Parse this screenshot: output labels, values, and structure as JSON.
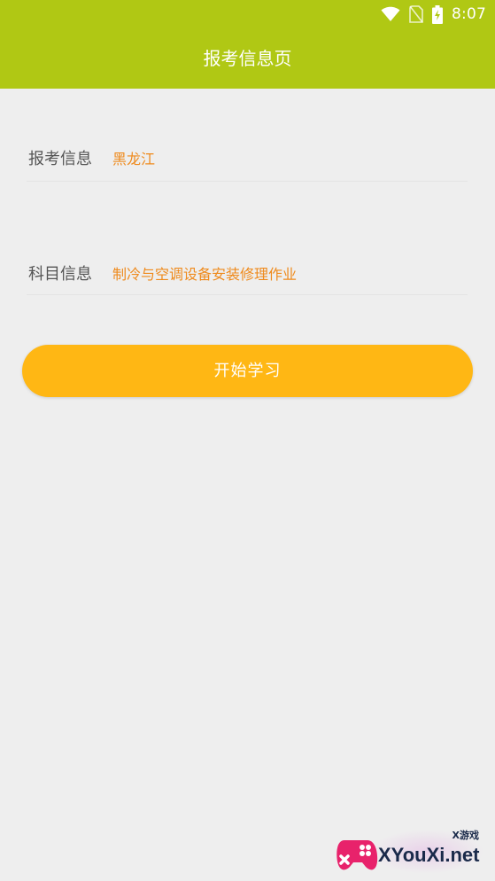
{
  "status_bar": {
    "time": "8:07",
    "icons": [
      "wifi-icon",
      "no-sim-icon",
      "battery-charging-icon"
    ]
  },
  "app_bar": {
    "title": "报考信息页",
    "color": "#b0c814"
  },
  "form": {
    "exam_info": {
      "label": "报考信息",
      "value": "黑龙江"
    },
    "subject_info": {
      "label": "科目信息",
      "value": "制冷与空调设备安装修理作业"
    }
  },
  "start_button": {
    "label": "开始学习",
    "color": "#ffb714"
  },
  "watermark": {
    "text": "XYouXi.net",
    "tag": "X游戏",
    "icon": "gamepad-icon"
  },
  "colors": {
    "value_text": "#ef8a1c",
    "background": "#eeeeee"
  }
}
